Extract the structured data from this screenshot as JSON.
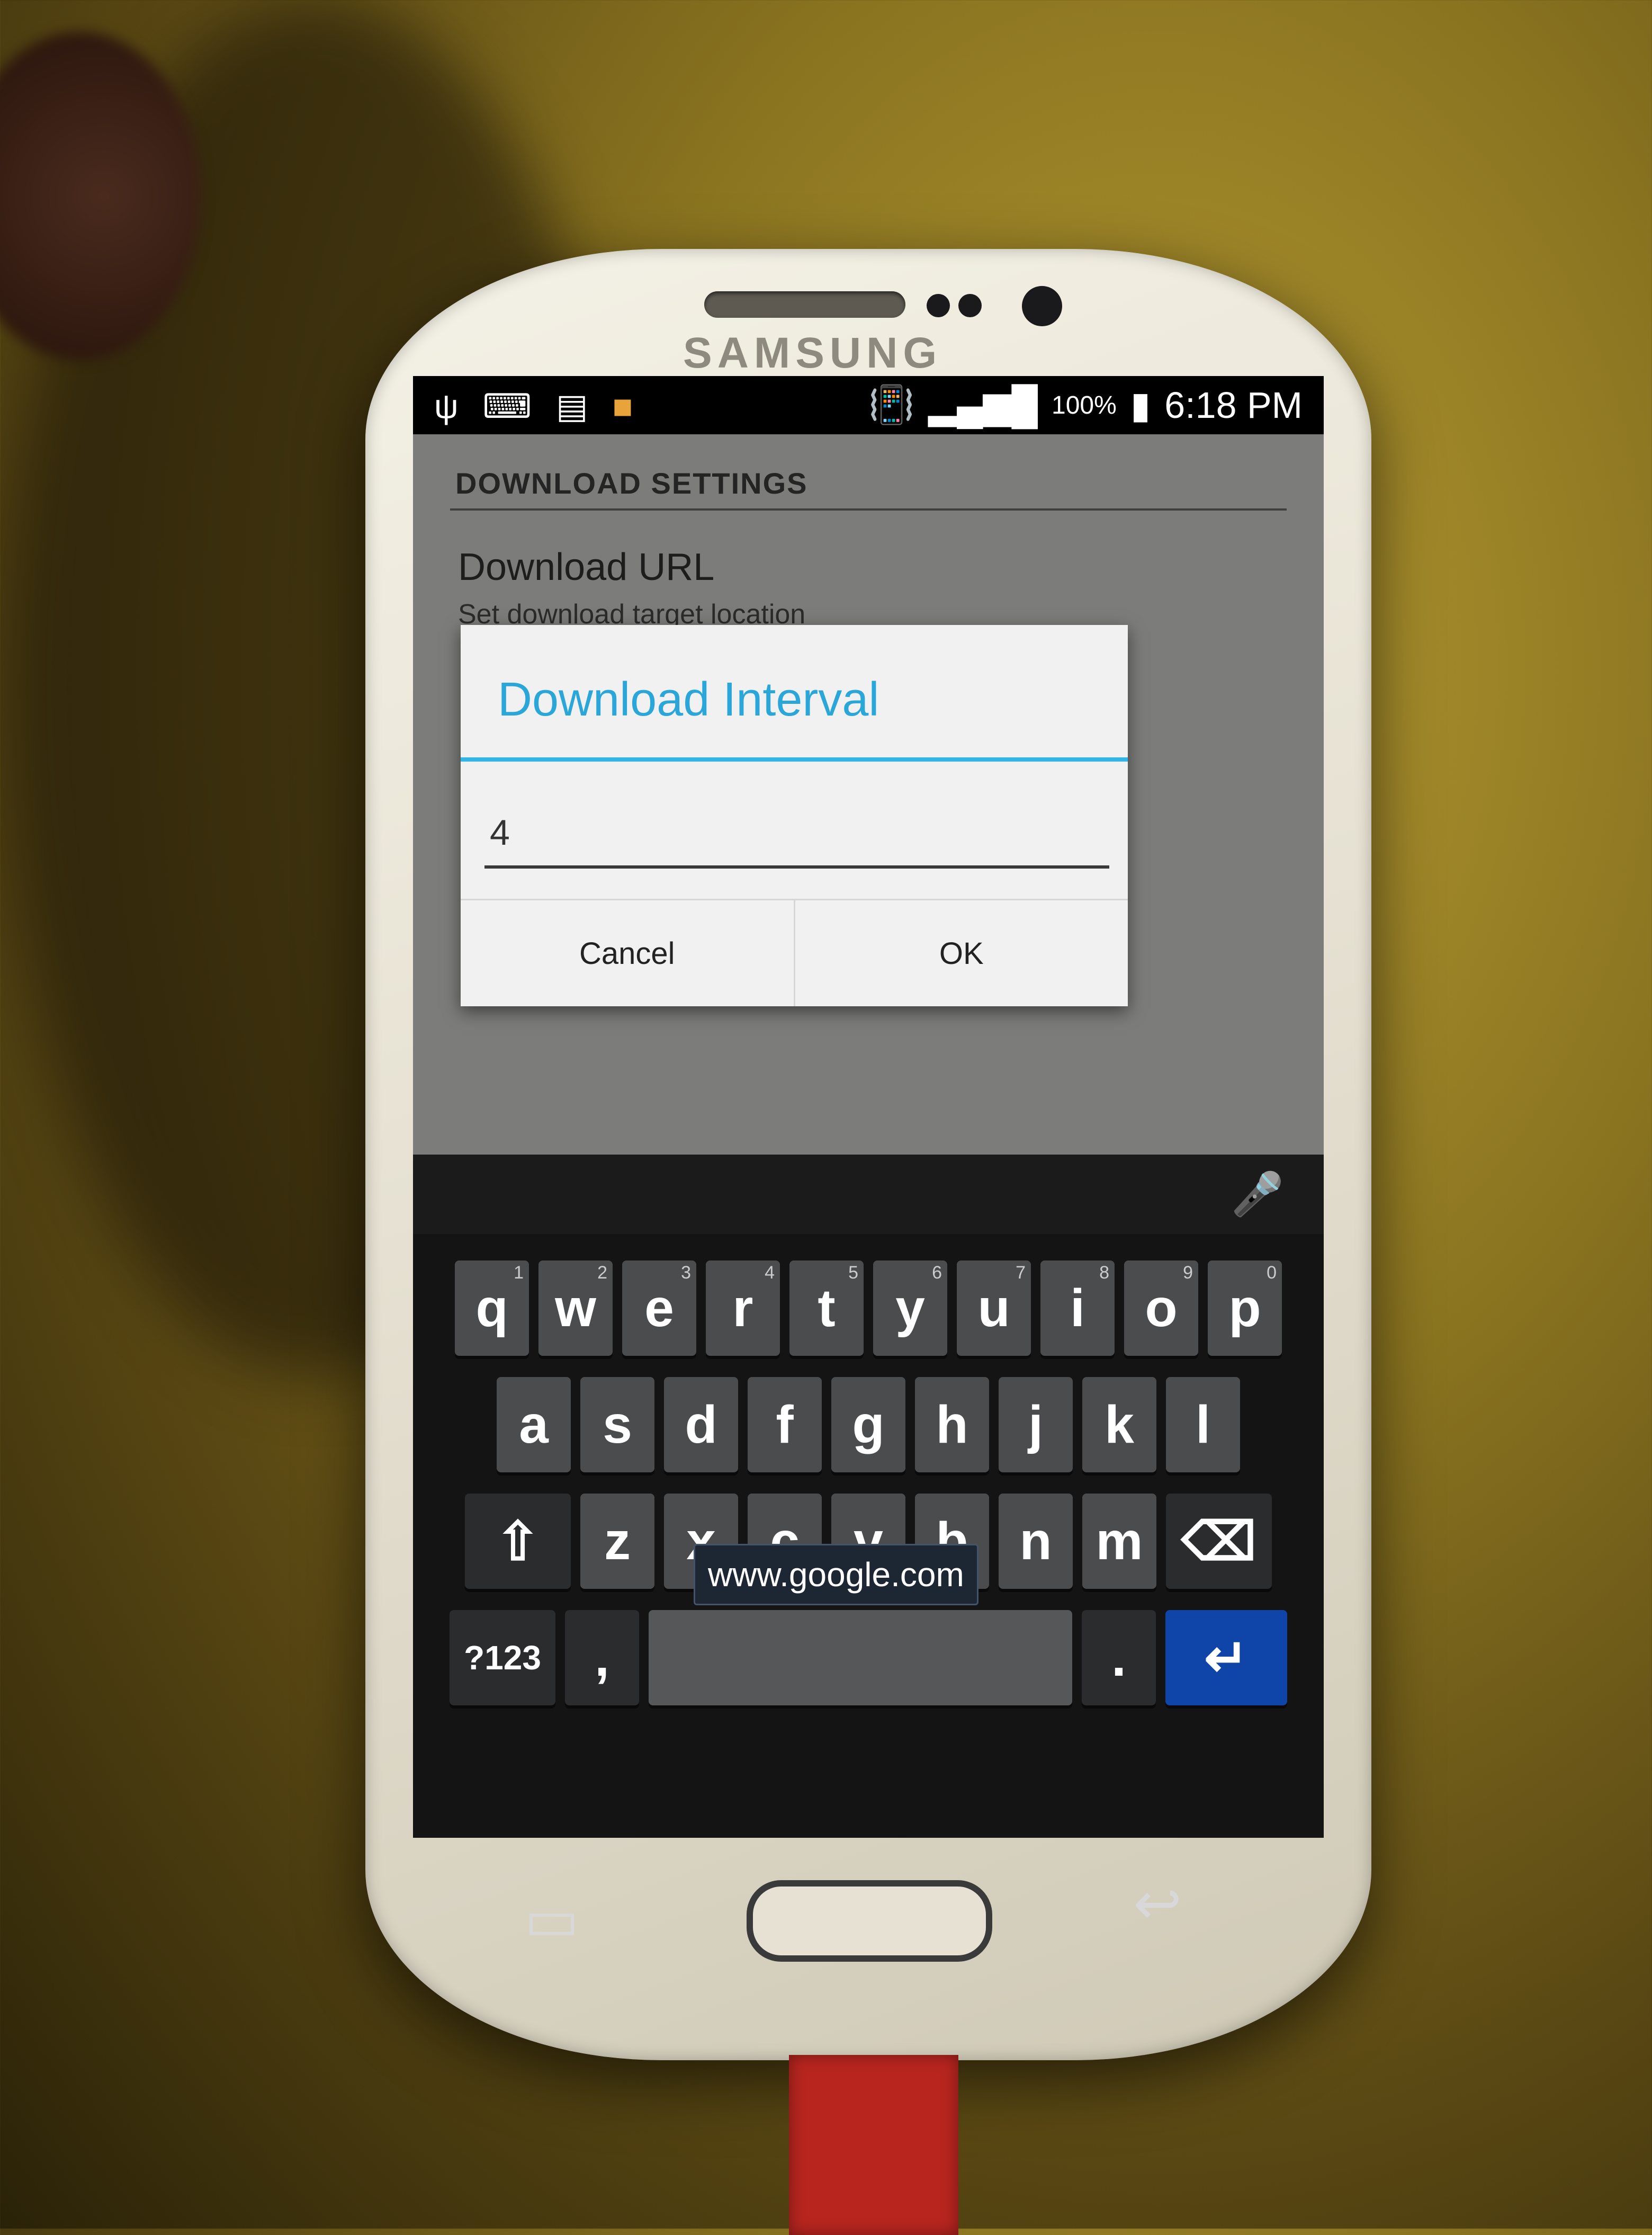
{
  "status_bar": {
    "icons_left": [
      "usb-icon",
      "keyboard-icon",
      "sd-card-icon",
      "app-icon"
    ],
    "battery_percent": "100%",
    "time": "6:18 PM"
  },
  "device": {
    "brand": "SAMSUNG"
  },
  "settings": {
    "section_header": "DOWNLOAD SETTINGS",
    "download_url_title": "Download URL",
    "download_url_summary": "Set download target location"
  },
  "dialog": {
    "title": "Download Interval",
    "input_value": "4",
    "cancel_label": "Cancel",
    "ok_label": "OK"
  },
  "keyboard": {
    "row1": [
      {
        "key": "q",
        "hint": "1"
      },
      {
        "key": "w",
        "hint": "2"
      },
      {
        "key": "e",
        "hint": "3"
      },
      {
        "key": "r",
        "hint": "4"
      },
      {
        "key": "t",
        "hint": "5"
      },
      {
        "key": "y",
        "hint": "6"
      },
      {
        "key": "u",
        "hint": "7"
      },
      {
        "key": "i",
        "hint": "8"
      },
      {
        "key": "o",
        "hint": "9"
      },
      {
        "key": "p",
        "hint": "0"
      }
    ],
    "row2": [
      "a",
      "s",
      "d",
      "f",
      "g",
      "h",
      "j",
      "k",
      "l"
    ],
    "row3": [
      "z",
      "x",
      "c",
      "v",
      "b",
      "n",
      "m"
    ],
    "symbols_label": "?123",
    "comma_label": ",",
    "period_label": ".",
    "suggestion": "www.google.com"
  },
  "colors": {
    "dialog_accent": "#33b5e5",
    "enter_key": "#0f44a8"
  }
}
